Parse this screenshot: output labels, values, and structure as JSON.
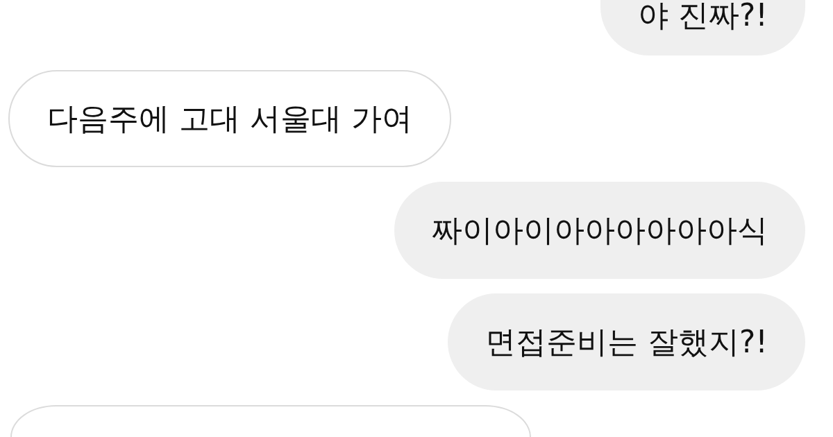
{
  "messages": [
    {
      "kind": "sent",
      "text": "야 진짜?!"
    },
    {
      "kind": "received",
      "text": "다음주에 고대 서울대 가여"
    },
    {
      "kind": "sent",
      "text": "짜이아이아아아아아아식"
    },
    {
      "kind": "sent",
      "text": "면접준비는 잘했지?!"
    },
    {
      "kind": "received"
    }
  ]
}
